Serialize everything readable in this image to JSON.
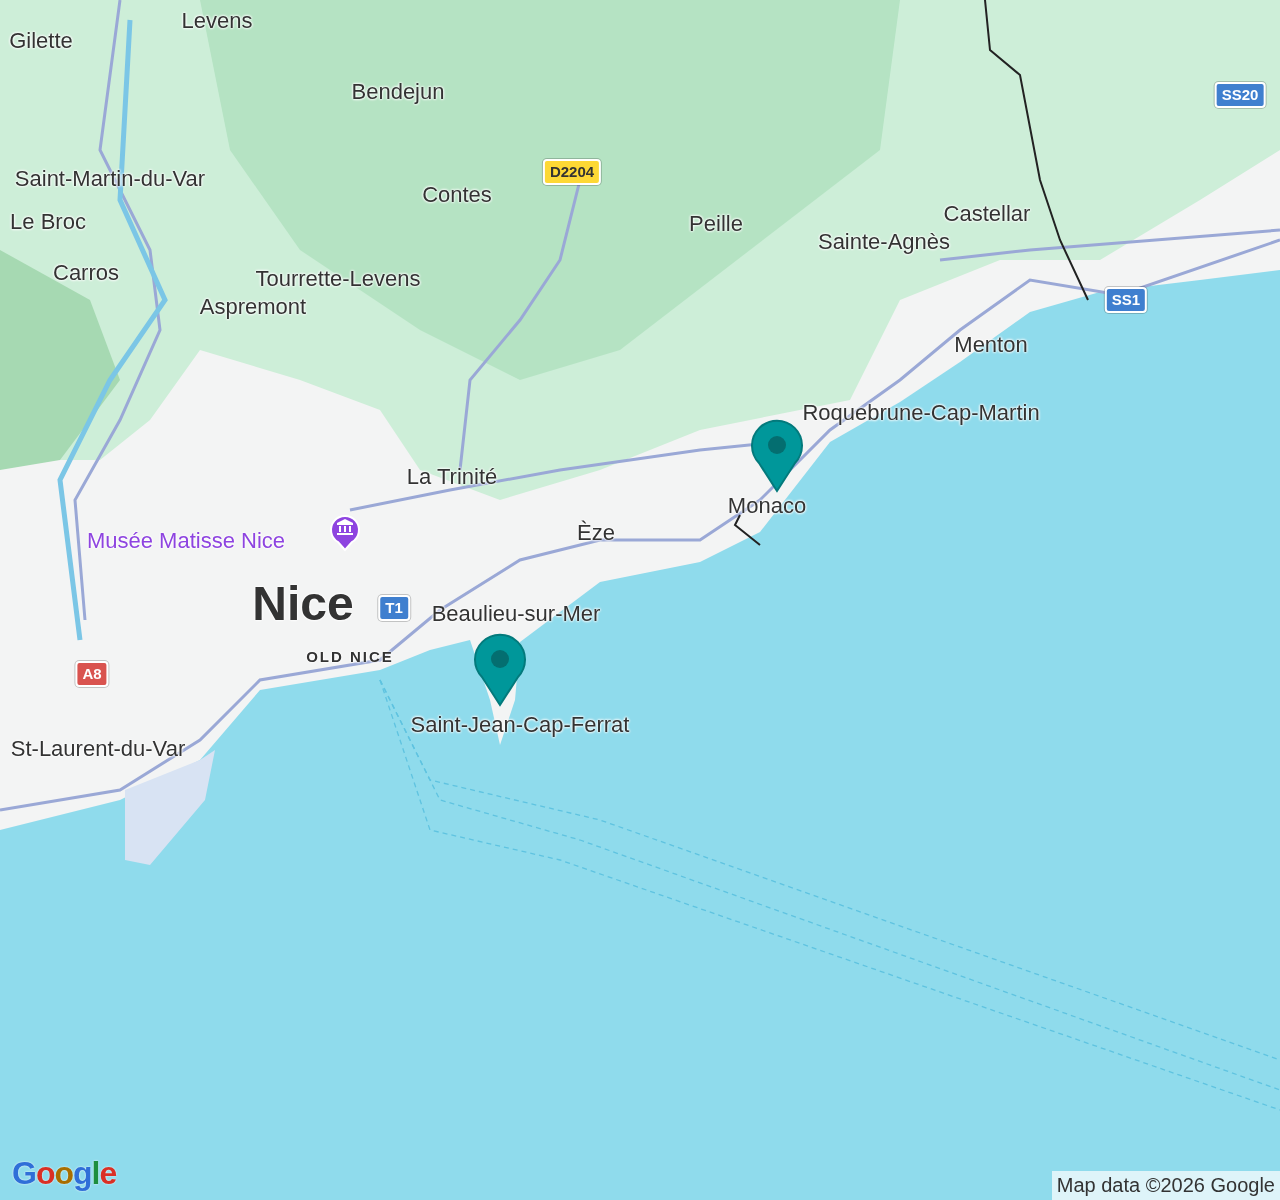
{
  "map": {
    "labels": [
      {
        "kind": "town",
        "text": "Gilette"
      },
      {
        "kind": "town",
        "text": "Levens"
      },
      {
        "kind": "town",
        "text": "Bendejun"
      },
      {
        "kind": "town",
        "text": "Saint-Martin-du-Var"
      },
      {
        "kind": "town",
        "text": "Contes"
      },
      {
        "kind": "town",
        "text": "Le Broc"
      },
      {
        "kind": "town",
        "text": "Carros"
      },
      {
        "kind": "town",
        "text": "Tourrette-Levens"
      },
      {
        "kind": "town",
        "text": "Aspremont"
      },
      {
        "kind": "town",
        "text": "Peille"
      },
      {
        "kind": "town",
        "text": "Castellar"
      },
      {
        "kind": "town",
        "text": "Sainte-Agnès"
      },
      {
        "kind": "town",
        "text": "Menton"
      },
      {
        "kind": "town",
        "text": "Roquebrune-Cap-Martin"
      },
      {
        "kind": "town",
        "text": "Monaco"
      },
      {
        "kind": "town",
        "text": "La Trinité"
      },
      {
        "kind": "town",
        "text": "Èze"
      },
      {
        "kind": "town",
        "text": "Beaulieu-sur-Mer"
      },
      {
        "kind": "town",
        "text": "Saint-Jean-Cap-Ferrat"
      },
      {
        "kind": "town",
        "text": "St-Laurent-du-Var"
      },
      {
        "kind": "city",
        "text": "Nice"
      },
      {
        "kind": "district",
        "text": "OLD NICE"
      },
      {
        "kind": "poi",
        "text": "Musée Matisse Nice"
      }
    ],
    "shields": [
      {
        "text": "D2204",
        "color": "#fdd835"
      },
      {
        "text": "SS20",
        "color": "#3f7fcf"
      },
      {
        "text": "SS1",
        "color": "#3f7fcf"
      },
      {
        "text": "T1",
        "color": "#3f7fcf"
      },
      {
        "text": "A8",
        "color": "#d9534f"
      }
    ],
    "logo": "Google",
    "attribution": "Map data ©2026 Google"
  }
}
